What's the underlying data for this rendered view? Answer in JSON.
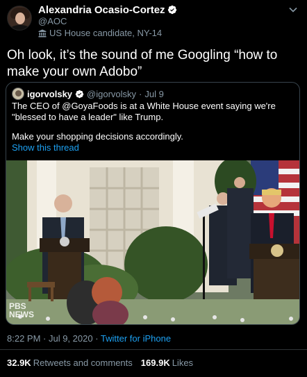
{
  "tweet": {
    "author_name": "Alexandria Ocasio-Cortez",
    "author_handle": "@AOC",
    "author_label": "US House candidate, NY-14",
    "text": "Oh look, it’s the sound of me Googling “how to make your own Adobo”",
    "timestamp": "8:22 PM · Jul 9, 2020",
    "source_separator": " · ",
    "source": "Twitter for iPhone",
    "retweets_count": "32.9K",
    "retweets_label": "Retweets and comments",
    "likes_count": "169.9K",
    "likes_label": "Likes"
  },
  "quoted_tweet": {
    "author_name": "igorvolsky",
    "author_handle": "@igorvolsky",
    "separator": "·",
    "date": "Jul 9",
    "text_line1": "The CEO of @GoyaFoods is at a White House event saying we're",
    "text_line2": "\"blessed to have a leader\" like Trump.",
    "text_line3": "Make your shopping decisions accordingly.",
    "show_thread": "Show this thread",
    "video_watermark_line1": "PBS",
    "video_watermark_line2": "NEWS"
  },
  "icons": {
    "verified": "verified-badge-icon",
    "label": "government-building-icon",
    "more": "chevron-down-icon"
  },
  "colors": {
    "background": "#000000",
    "text_primary": "#ffffff",
    "text_secondary": "#8899a6",
    "link": "#1da1f2",
    "border": "#38444d"
  }
}
